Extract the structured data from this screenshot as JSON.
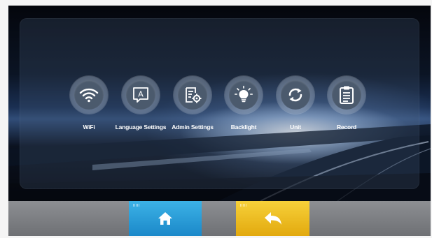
{
  "menu": {
    "items": [
      {
        "id": "wifi",
        "label": "WiFi",
        "icon": "wifi-icon"
      },
      {
        "id": "language",
        "label": "Language Settings",
        "icon": "language-icon"
      },
      {
        "id": "admin",
        "label": "Admin Settings",
        "icon": "admin-settings-icon"
      },
      {
        "id": "backlight",
        "label": "Backlight",
        "icon": "lightbulb-icon"
      },
      {
        "id": "unit",
        "label": "Unit",
        "icon": "refresh-icon"
      },
      {
        "id": "record",
        "label": "Record",
        "icon": "clipboard-icon"
      }
    ],
    "language_icon_letter": "A"
  },
  "bottom_bar": {
    "home_icon": "home-icon",
    "back_icon": "back-arrow-icon"
  },
  "colors": {
    "home_button": "#2aa0dc",
    "back_button": "#f0c020",
    "icon_disc": "#4b5a6d"
  }
}
